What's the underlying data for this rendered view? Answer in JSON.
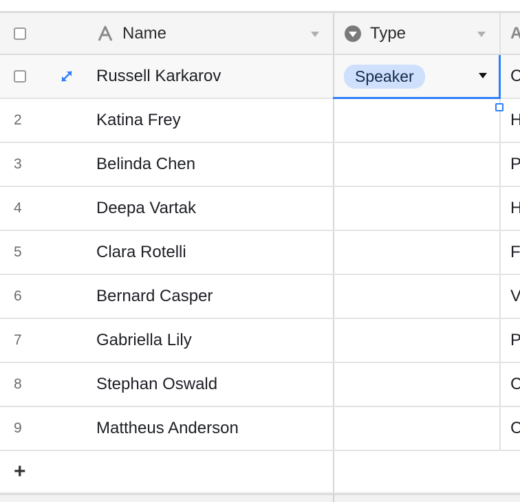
{
  "columns": {
    "name": "Name",
    "type": "Type",
    "next_partial": "A"
  },
  "rows": [
    {
      "num": "",
      "name": "Russell Karkarov",
      "type": "Speaker",
      "next": "C"
    },
    {
      "num": "2",
      "name": "Katina Frey",
      "type": "",
      "next": "H"
    },
    {
      "num": "3",
      "name": "Belinda Chen",
      "type": "",
      "next": "P"
    },
    {
      "num": "4",
      "name": "Deepa Vartak",
      "type": "",
      "next": "H"
    },
    {
      "num": "5",
      "name": "Clara Rotelli",
      "type": "",
      "next": "F"
    },
    {
      "num": "6",
      "name": "Bernard Casper",
      "type": "",
      "next": "V"
    },
    {
      "num": "7",
      "name": "Gabriella Lily",
      "type": "",
      "next": "P"
    },
    {
      "num": "8",
      "name": "Stephan Oswald",
      "type": "",
      "next": "C"
    },
    {
      "num": "9",
      "name": "Mattheus Anderson",
      "type": "",
      "next": "C"
    }
  ],
  "add_row": {
    "label": "+"
  },
  "colors": {
    "accent": "#2d7ff9",
    "pill_bg": "#cfe0fc"
  },
  "icons": {
    "name_column": "text-field-icon",
    "type_column": "single-select-icon",
    "expand": "expand-record-icon"
  }
}
